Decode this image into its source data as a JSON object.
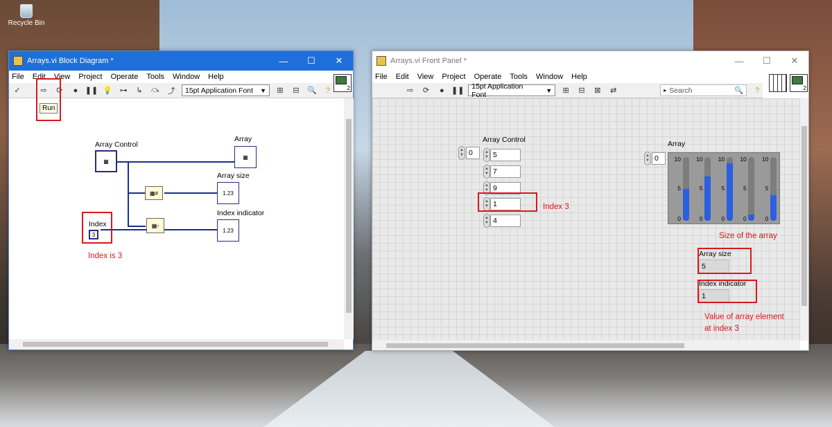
{
  "desktop": {
    "recycle_bin_label": "Recycle Bin"
  },
  "block_diagram": {
    "title": "Arrays.vi Block Diagram *",
    "menu": [
      "File",
      "Edit",
      "View",
      "Project",
      "Operate",
      "Tools",
      "Window",
      "Help"
    ],
    "font_selector": "15pt Application Font",
    "run_tooltip": "Run",
    "conn_number": "2",
    "labels": {
      "array_control": "Array Control",
      "array": "Array",
      "array_size": "Array size",
      "index": "Index",
      "index_indicator": "Index indicator"
    },
    "index_value": "3",
    "annotation": "Index is 3"
  },
  "front_panel": {
    "title": "Arrays.vi Front Panel *",
    "menu": [
      "File",
      "Edit",
      "View",
      "Project",
      "Operate",
      "Tools",
      "Window",
      "Help"
    ],
    "font_selector": "15pt Application Font",
    "search_placeholder": "Search",
    "conn_number": "2",
    "array_control": {
      "label": "Array Control",
      "index": "0",
      "values": [
        "5",
        "7",
        "9",
        "1",
        "4"
      ]
    },
    "array": {
      "label": "Array",
      "index": "0",
      "scale": [
        "10",
        "5",
        "0"
      ],
      "fill_levels": [
        5,
        7,
        9,
        1,
        4
      ]
    },
    "array_size": {
      "label": "Array size",
      "value": "5"
    },
    "index_indicator": {
      "label": "Index indicator",
      "value": "1"
    },
    "annotations": {
      "index3": "Index 3",
      "size": "Size of the array",
      "value_line1": "Value of array element",
      "value_line2": "at index 3"
    }
  }
}
